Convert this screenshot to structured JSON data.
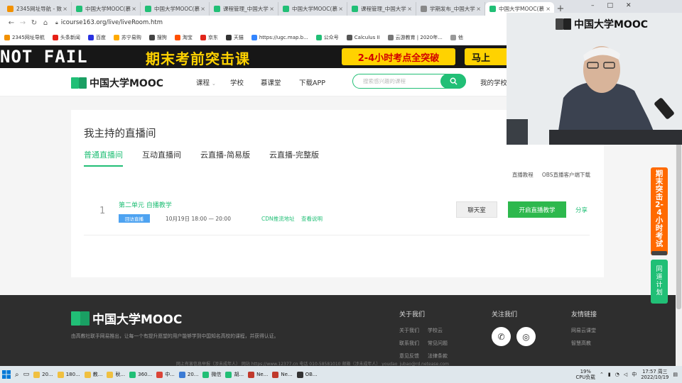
{
  "browser": {
    "tabs": [
      {
        "label": "2345网址导航 - 致",
        "color": "#f29100"
      },
      {
        "label": "中国大学MOOC(慕",
        "color": "#21bf76"
      },
      {
        "label": "中国大学MOOC(慕",
        "color": "#21bf76"
      },
      {
        "label": "课程管理_中国大学",
        "color": "#21bf76"
      },
      {
        "label": "中国大学MOOC(慕",
        "color": "#21bf76"
      },
      {
        "label": "课程管理_中国大学",
        "color": "#21bf76"
      },
      {
        "label": "学期发布_中国大学",
        "color": "#888888"
      },
      {
        "label": "中国大学MOOC(慕",
        "color": "#21bf76",
        "active": true
      }
    ],
    "new_tab_label": "+",
    "window_controls": {
      "minimize": "–",
      "maximize": "□",
      "close": "✕"
    },
    "url": "icourse163.org/live/liveRoom.htm",
    "bookmarks": [
      {
        "label": "2345网址导航",
        "color": "#f29100"
      },
      {
        "label": "头条新闻",
        "color": "#e62117"
      },
      {
        "label": "百度",
        "color": "#2932e1"
      },
      {
        "label": "苏宁易购",
        "color": "#ffaa00"
      },
      {
        "label": "搜狗",
        "color": "#444444"
      },
      {
        "label": "淘宝",
        "color": "#ff5000"
      },
      {
        "label": "京东",
        "color": "#e1251b"
      },
      {
        "label": "天猫",
        "color": "#333333"
      },
      {
        "label": "https://ugc.map.b...",
        "color": "#3385ff"
      },
      {
        "label": "公众号",
        "color": "#21bf76"
      },
      {
        "label": "Calculus II",
        "color": "#555555"
      },
      {
        "label": "云游教育 | 2020年...",
        "color": "#777777"
      },
      {
        "label": "他",
        "color": "#999999"
      }
    ]
  },
  "banner": {
    "left_text": "NOT FAIL",
    "main_text": "期末考前突击课",
    "pill_text": "2-4小时考点全突破",
    "cta_text": "马上"
  },
  "header": {
    "logo_text": "中国大学MOOC",
    "nav": [
      "课程",
      "学校",
      "慕课堂",
      "下载APP"
    ],
    "course_caret": "⌄",
    "search_placeholder": "搜索感兴趣的课程",
    "my_school": "我的学校"
  },
  "main": {
    "title": "我主持的直播间",
    "tabs": [
      "普通直播间",
      "互动直播间",
      "云直播-简易版",
      "云直播-完整版"
    ],
    "links": [
      "直播教程",
      "OBS直播客户端下载"
    ],
    "rows": [
      {
        "num": "1",
        "name": "第二单元 自播教学",
        "badge": "回访直播",
        "time": "10月19日 18:00 — 20:00",
        "cdn": "CDN推流地址",
        "help": "查看说明",
        "chat_btn": "聊天室",
        "start_btn": "开启直播教学",
        "share": "分享"
      }
    ]
  },
  "footer": {
    "logo_text": "中国大学MOOC",
    "desc": "由高教社联手网易推出，让每一个有提升愿望的用户能够学到中国知名高校的课程，并获得认证。",
    "about_title": "关于我们",
    "about_links": [
      [
        "关于我们",
        "学校云"
      ],
      [
        "联系我们",
        "常见问题"
      ],
      [
        "意见反馈",
        "法律条款"
      ]
    ],
    "follow_title": "关注我们",
    "friend_title": "友情链接",
    "friend_links": [
      "网易云课堂",
      "智慧高教"
    ],
    "copyright": "网上有害信息举报（涉未成年人）   网站 https://www.12377.cn 电话 010-58581010 邮箱（涉未成年人） youdao_jubao@rd.netease.com"
  },
  "float_ad": {
    "text": "期末突击2-4小时考试"
  },
  "float_plan": {
    "text": "同道计划"
  },
  "webcam": {
    "logo_text": "中国大学MOOC"
  },
  "taskbar": {
    "items": [
      {
        "label": "20...",
        "color": "#f0c040"
      },
      {
        "label": "180...",
        "color": "#f0c040"
      },
      {
        "label": "教...",
        "color": "#f0c040"
      },
      {
        "label": "秋...",
        "color": "#f0c040"
      },
      {
        "label": "360...",
        "color": "#21bf76"
      },
      {
        "label": "中...",
        "color": "#db4437"
      },
      {
        "label": "20...",
        "color": "#3b7bd4"
      },
      {
        "label": "微信",
        "color": "#21bf76"
      },
      {
        "label": "胡...",
        "color": "#21bf76"
      },
      {
        "label": "Ne...",
        "color": "#c0392b"
      },
      {
        "label": "Ne...",
        "color": "#c0392b"
      },
      {
        "label": "OB...",
        "color": "#333333"
      }
    ],
    "cpu": "19%",
    "cpu_label": "CPU负载",
    "ime": "中",
    "time": "17:57 周三",
    "date": "2022/10/19"
  }
}
